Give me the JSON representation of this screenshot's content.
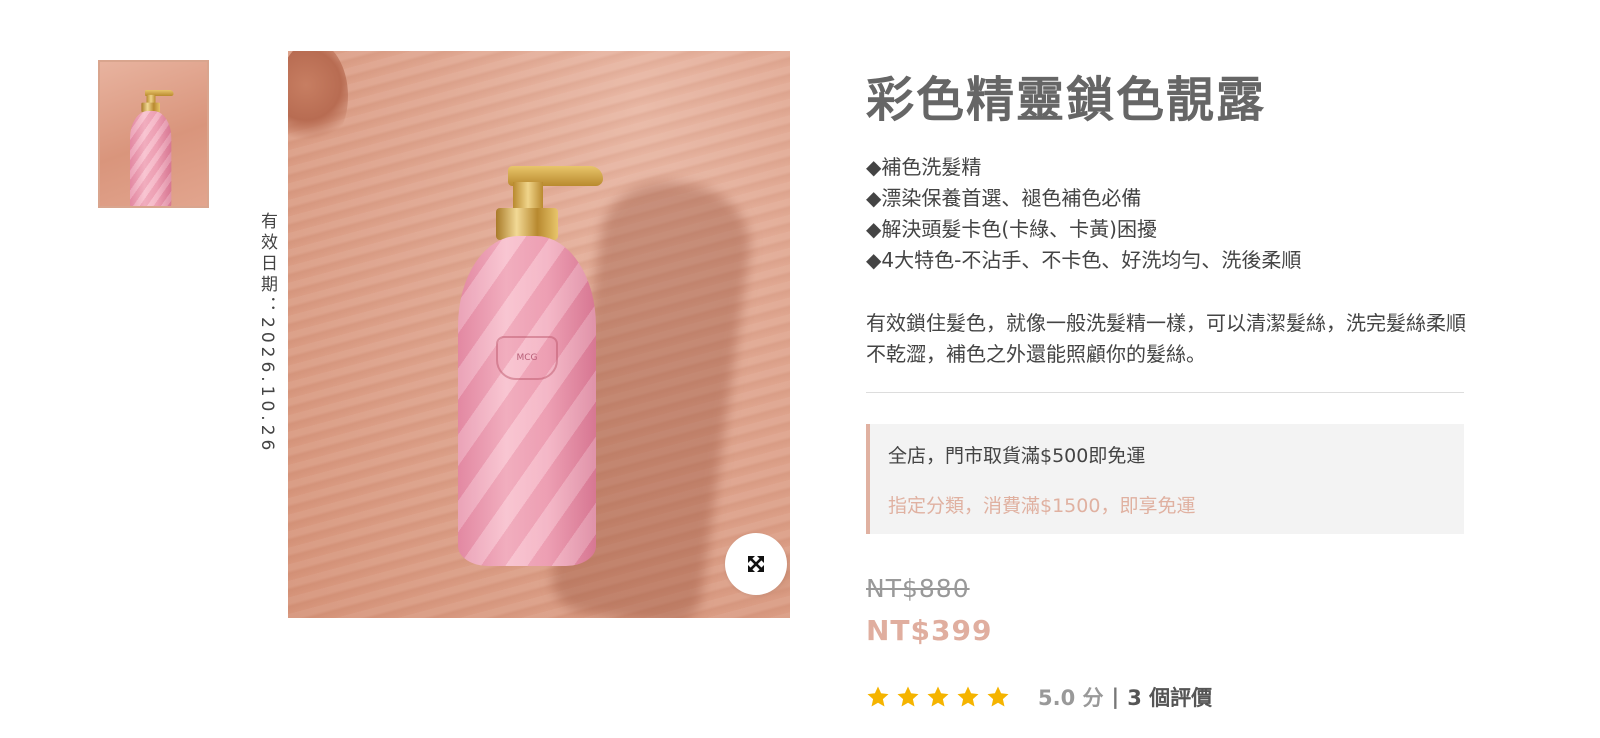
{
  "gallery": {
    "thumbnail_alt": "product thumbnail",
    "expiry": "有效日期：2026.10.26",
    "bottle_logo": "MCG"
  },
  "product": {
    "title": "彩色精靈鎖色靚露",
    "features": [
      "◆補色洗髮精",
      "◆漂染保養首選、褪色補色必備",
      "◆解決頭髮卡色(卡綠、卡黃)困擾",
      "◆4大特色-不沾手、不卡色、好洗均勻、洗後柔順"
    ],
    "description": "有效鎖住髮色，就像一般洗髮精一樣，可以清潔髮絲，洗完髮絲柔順不乾澀，補色之外還能照顧你的髮絲。"
  },
  "promo": {
    "line1": "全店，門市取貨滿$500即免運",
    "line2": "指定分類，消費滿$1500，即享免運"
  },
  "price": {
    "original": "NT$880",
    "sale": "NT$399"
  },
  "rating": {
    "stars": 5,
    "score": "5.0 分",
    "separator": "|",
    "count": "3 個評價"
  },
  "colors": {
    "accent": "#e0ae9f",
    "star": "#f5b400",
    "title": "#666666"
  },
  "icons": {
    "expand": "expand-arrows-icon",
    "star": "star-icon"
  }
}
